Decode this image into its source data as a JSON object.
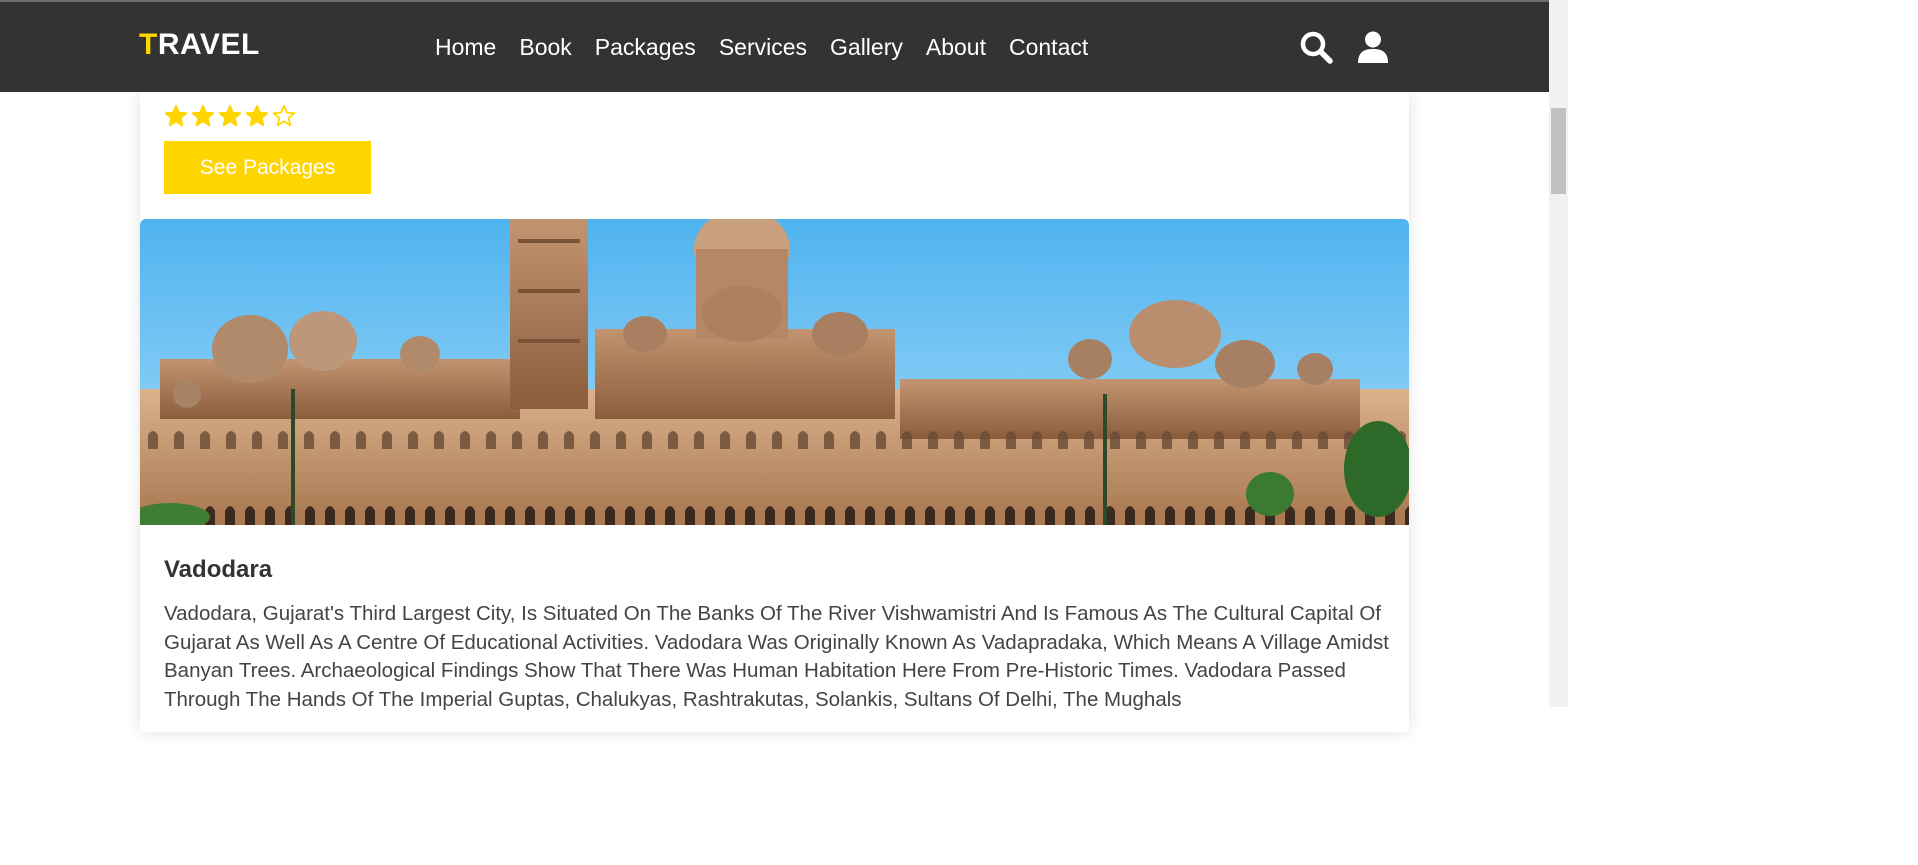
{
  "nav": {
    "logo_first": "T",
    "logo_rest": "RAVEL",
    "links": [
      "Home",
      "Book",
      "Packages",
      "Services",
      "Gallery",
      "About",
      "Contact"
    ],
    "icons": [
      "search-icon",
      "user-icon"
    ]
  },
  "card": {
    "rating": 4,
    "rating_max": 5,
    "button_label": "See Packages",
    "image_alt": "Vadodara palace",
    "title": "Vadodara",
    "description": "Vadodara, Gujarat's Third Largest City, Is Situated On The Banks Of The River Vishwamistri And Is Famous As The Cultural Capital Of Gujarat As Well As A Centre Of Educational Activities. Vadodara Was Originally Known As Vadapradaka, Which Means A Village Amidst Banyan Trees. Archaeological Findings Show That There Was Human Habitation Here From Pre-Historic Times. Vadodara Passed Through The Hands Of The Imperial Guptas, Chalukyas, Rashtrakutas, Solankis, Sultans Of Delhi, The Mughals"
  },
  "colors": {
    "accent": "#ffd500",
    "navbar": "#333333",
    "text": "#333333"
  }
}
